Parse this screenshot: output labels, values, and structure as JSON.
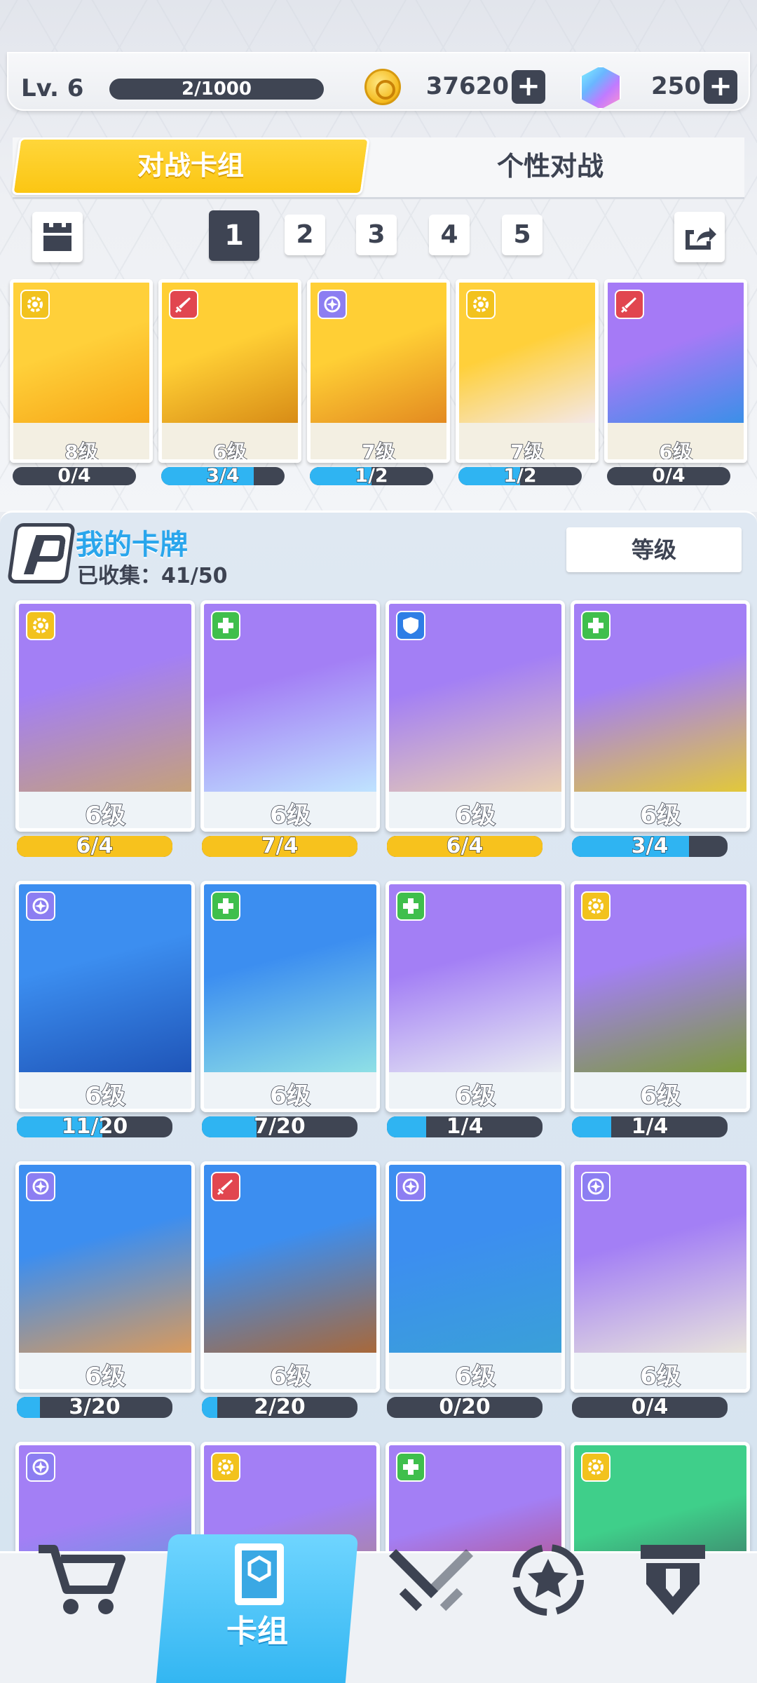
{
  "header": {
    "level": "Lv. 6",
    "xp": "2/1000",
    "gold": "37620",
    "gems": "250",
    "plus": "+"
  },
  "tabs": {
    "battle_deck": "对战卡组",
    "custom_battle": "个性对战"
  },
  "deck_pages": [
    "1",
    "2",
    "3",
    "4",
    "5"
  ],
  "deck": [
    {
      "level": "8级",
      "progress": "0/4",
      "ratio": 0,
      "type": "gear",
      "bar": "#2fb4f2",
      "art": [
        "#ffd03a",
        "#f6a516"
      ]
    },
    {
      "level": "6级",
      "progress": "3/4",
      "ratio": 0.75,
      "type": "sword",
      "bar": "#2fb4f2",
      "art": [
        "#ffcf35",
        "#d88c16"
      ]
    },
    {
      "level": "7级",
      "progress": "1/2",
      "ratio": 0.5,
      "type": "arcane",
      "bar": "#2fb4f2",
      "art": [
        "#ffcf35",
        "#e38a20"
      ]
    },
    {
      "level": "7级",
      "progress": "1/2",
      "ratio": 0.5,
      "type": "gear",
      "bar": "#2fb4f2",
      "art": [
        "#ffd03a",
        "#f4e8e8"
      ]
    },
    {
      "level": "6级",
      "progress": "0/4",
      "ratio": 0,
      "type": "sword",
      "bar": "#2fb4f2",
      "art": [
        "#a57af6",
        "#3b8fe8"
      ]
    }
  ],
  "collection": {
    "title": "我的卡牌",
    "collected": "已收集：41/50",
    "sort_label": "等级"
  },
  "cards": [
    {
      "level": "6级",
      "progress": "6/4",
      "ratio": 1,
      "type": "gear",
      "bar": "#f7c21d",
      "art": [
        "#a37ff5",
        "#c5a17a"
      ]
    },
    {
      "level": "6级",
      "progress": "7/4",
      "ratio": 1,
      "type": "heal",
      "bar": "#f7c21d",
      "art": [
        "#a37ff5",
        "#bfe3ff"
      ]
    },
    {
      "level": "6级",
      "progress": "6/4",
      "ratio": 1,
      "type": "shield",
      "bar": "#f7c21d",
      "art": [
        "#a37ff5",
        "#e9cfb0"
      ]
    },
    {
      "level": "6级",
      "progress": "3/4",
      "ratio": 0.75,
      "type": "heal",
      "bar": "#2fb4f2",
      "art": [
        "#a37ff5",
        "#e2c83a"
      ]
    },
    {
      "level": "6级",
      "progress": "11/20",
      "ratio": 0.55,
      "type": "arcane",
      "bar": "#2fb4f2",
      "art": [
        "#3c8ef0",
        "#1f55b8"
      ]
    },
    {
      "level": "6级",
      "progress": "7/20",
      "ratio": 0.35,
      "type": "heal",
      "bar": "#2fb4f2",
      "art": [
        "#3c8ef0",
        "#8fe0e6"
      ]
    },
    {
      "level": "6级",
      "progress": "1/4",
      "ratio": 0.25,
      "type": "heal",
      "bar": "#2fb4f2",
      "art": [
        "#a37ff5",
        "#e8ecf2"
      ]
    },
    {
      "level": "6级",
      "progress": "1/4",
      "ratio": 0.25,
      "type": "gear",
      "bar": "#2fb4f2",
      "art": [
        "#a37ff5",
        "#7c9a3c"
      ]
    },
    {
      "level": "6级",
      "progress": "3/20",
      "ratio": 0.15,
      "type": "arcane",
      "bar": "#2fb4f2",
      "art": [
        "#3c8ef0",
        "#d99a5c"
      ]
    },
    {
      "level": "6级",
      "progress": "2/20",
      "ratio": 0.1,
      "type": "sword",
      "bar": "#2fb4f2",
      "art": [
        "#3c8ef0",
        "#a8683a"
      ]
    },
    {
      "level": "6级",
      "progress": "0/20",
      "ratio": 0,
      "type": "arcane",
      "bar": "#2fb4f2",
      "art": [
        "#3c8ef0",
        "#3aa0d8"
      ]
    },
    {
      "level": "6级",
      "progress": "0/4",
      "ratio": 0,
      "type": "arcane",
      "bar": "#2fb4f2",
      "art": [
        "#a37ff5",
        "#e8e4dc"
      ]
    },
    {
      "level": "",
      "progress": "",
      "ratio": 0,
      "type": "arcane",
      "bar": "#2fb4f2",
      "art": [
        "#a37ff5",
        "#4aa0d0"
      ]
    },
    {
      "level": "",
      "progress": "",
      "ratio": 0,
      "type": "gear",
      "bar": "#2fb4f2",
      "art": [
        "#a37ff5",
        "#b08a60"
      ]
    },
    {
      "level": "",
      "progress": "",
      "ratio": 0,
      "type": "heal",
      "bar": "#2fb4f2",
      "art": [
        "#a37ff5",
        "#c23848"
      ]
    },
    {
      "level": "",
      "progress": "",
      "ratio": 0,
      "type": "gear",
      "bar": "#2fb4f2",
      "art": [
        "#3fcf8a",
        "#3c4654"
      ]
    }
  ],
  "nav": {
    "deck_label": "卡组",
    "items": [
      "cart-icon",
      "deck-icon",
      "swords-icon",
      "star-rank-icon",
      "guild-tower-icon"
    ]
  }
}
